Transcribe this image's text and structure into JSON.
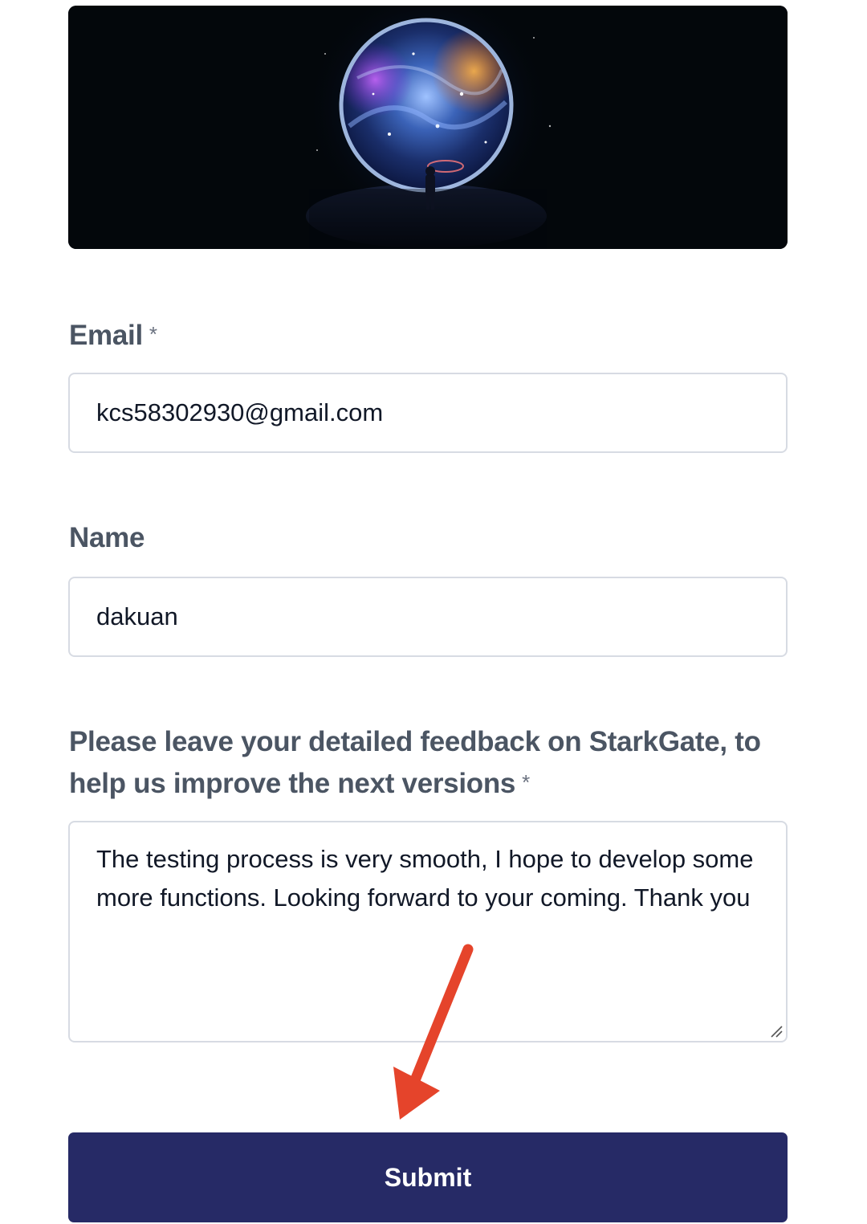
{
  "banner": {
    "image_icon": "space-portal-astronaut-image"
  },
  "form": {
    "email": {
      "label": "Email",
      "required_mark": "*",
      "value": "kcs58302930@gmail.com"
    },
    "name": {
      "label": "Name",
      "value": "dakuan"
    },
    "feedback": {
      "label": "Please leave your detailed feedback on StarkGate, to help us improve the next versions",
      "required_mark": "*",
      "value": "The testing process is very smooth, I hope to develop some more functions. Looking forward to your coming. Thank you"
    },
    "submit_label": "Submit"
  },
  "annotation": {
    "arrow_icon": "red-arrow-pointing-down-icon",
    "arrow_color": "#e5442b"
  },
  "colors": {
    "button_bg": "#262a66",
    "label_text": "#4b5563",
    "input_border": "#d7dbe3"
  }
}
